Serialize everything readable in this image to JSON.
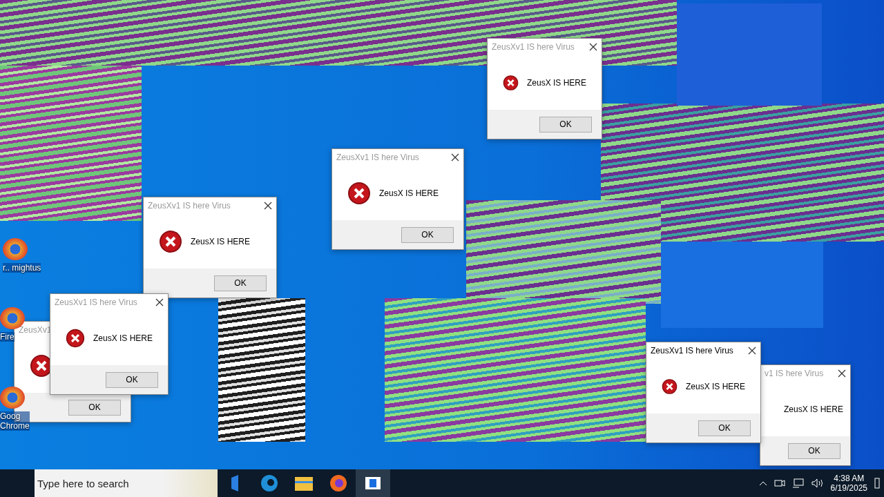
{
  "desktop_icons": [
    {
      "label": "r.. mightus"
    },
    {
      "label": "Fire"
    },
    {
      "label": "Goog\nChrome"
    }
  ],
  "dialogs": [
    {
      "title": "ZeusXv1",
      "button": "OK",
      "active": false
    },
    {
      "title": "ZeusXv1 IS here Virus",
      "message": "ZeusX IS HERE",
      "button": "OK",
      "active": false
    },
    {
      "title": "ZeusXv1 IS here Virus",
      "message": "ZeusX IS HERE",
      "button": "OK",
      "active": false
    },
    {
      "title": "ZeusXv1 IS here Virus",
      "message": "ZeusX IS HERE",
      "button": "OK",
      "active": false
    },
    {
      "title": "ZeusXv1 IS here Virus",
      "message": "ZeusX IS HERE",
      "button": "OK",
      "active": false
    },
    {
      "title": "v1 IS here Virus",
      "message": "ZeusX IS HERE",
      "button": "OK",
      "active": false
    },
    {
      "title": "ZeusXv1 IS here Virus",
      "message": "ZeusX IS HERE",
      "button": "OK",
      "active": true
    }
  ],
  "taskbar": {
    "search": {
      "placeholder": "Type here to search"
    },
    "clock": {
      "time": "4:38 AM",
      "date": "6/19/2025"
    }
  }
}
